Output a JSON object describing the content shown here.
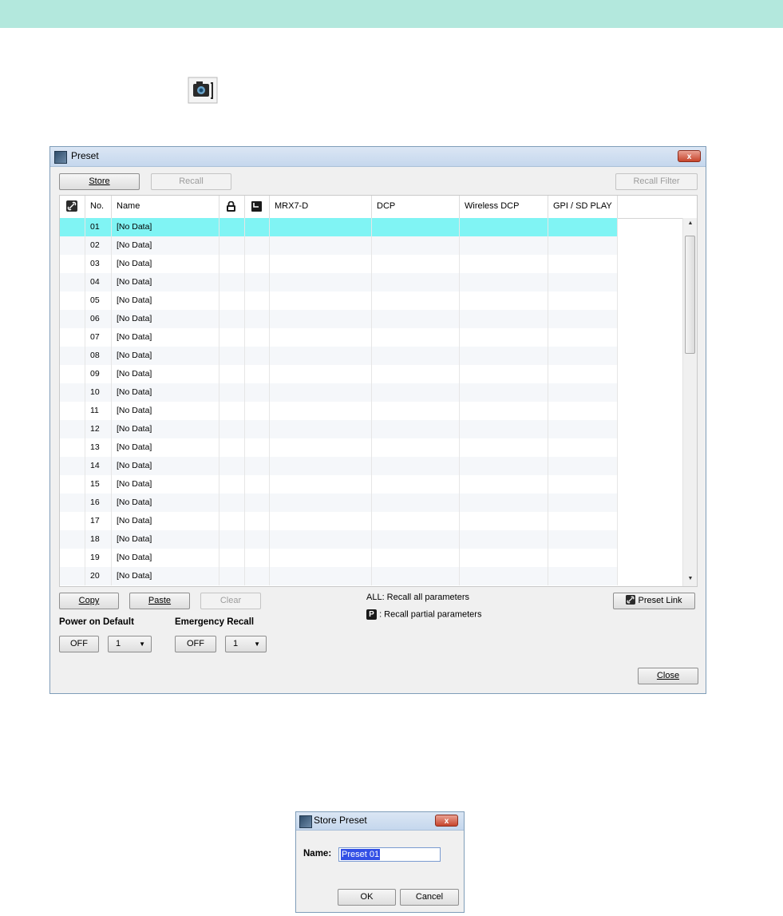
{
  "preset_window": {
    "title": "Preset",
    "close_glyph": "x",
    "toolbar": {
      "store": "Store",
      "recall": "Recall",
      "recall_filter": "Recall Filter"
    },
    "columns": {
      "link_icon": "link-icon",
      "no": "No.",
      "name": "Name",
      "lock_icon": "lock-icon",
      "clock_icon": "clock-icon",
      "mrx7d": "MRX7-D",
      "dcp": "DCP",
      "wireless_dcp": "Wireless DCP",
      "gpi_sd_play": "GPI / SD PLAY"
    },
    "rows": [
      {
        "no": "01",
        "name": "[No Data]",
        "selected": true
      },
      {
        "no": "02",
        "name": "[No Data]"
      },
      {
        "no": "03",
        "name": "[No Data]"
      },
      {
        "no": "04",
        "name": "[No Data]"
      },
      {
        "no": "05",
        "name": "[No Data]"
      },
      {
        "no": "06",
        "name": "[No Data]"
      },
      {
        "no": "07",
        "name": "[No Data]"
      },
      {
        "no": "08",
        "name": "[No Data]"
      },
      {
        "no": "09",
        "name": "[No Data]"
      },
      {
        "no": "10",
        "name": "[No Data]"
      },
      {
        "no": "11",
        "name": "[No Data]"
      },
      {
        "no": "12",
        "name": "[No Data]"
      },
      {
        "no": "13",
        "name": "[No Data]"
      },
      {
        "no": "14",
        "name": "[No Data]"
      },
      {
        "no": "15",
        "name": "[No Data]"
      },
      {
        "no": "16",
        "name": "[No Data]"
      },
      {
        "no": "17",
        "name": "[No Data]"
      },
      {
        "no": "18",
        "name": "[No Data]"
      },
      {
        "no": "19",
        "name": "[No Data]"
      },
      {
        "no": "20",
        "name": "[No Data]"
      }
    ],
    "bottom": {
      "copy": "Copy",
      "paste": "Paste",
      "clear": "Clear",
      "legend_all": "ALL: Recall all parameters",
      "legend_p_badge": "P",
      "legend_partial": ": Recall partial parameters",
      "preset_link": "Preset Link",
      "power_on_default_label": "Power on Default",
      "power_on_value": "OFF",
      "power_on_select": "1",
      "emergency_recall_label": "Emergency Recall",
      "emergency_value": "OFF",
      "emergency_select": "1",
      "close": "Close"
    },
    "selected_row_color": "#80f4f4"
  },
  "store_dialog": {
    "title": "Store Preset",
    "close_glyph": "x",
    "name_label": "Name:",
    "name_value": "Preset 01",
    "ok": "OK",
    "cancel": "Cancel"
  },
  "colors": {
    "top_band": "#b3e8dd",
    "selection_highlight": "#3350e6"
  }
}
